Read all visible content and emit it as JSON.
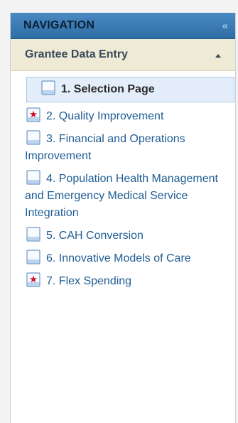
{
  "navigation": {
    "title": "NAVIGATION",
    "collapse_glyph": "«",
    "section": {
      "label": "Grantee Data Entry",
      "expanded": true
    },
    "items": [
      {
        "label": "1. Selection Page",
        "icon": "blank-page-icon",
        "active": true
      },
      {
        "label": "2. Quality Improvement",
        "icon": "flagged-page-icon",
        "active": false
      },
      {
        "label": "3. Financial and Operations Improvement",
        "icon": "blank-page-icon",
        "active": false
      },
      {
        "label": "4. Population Health Management and Emergency Medical Service Integration",
        "icon": "blank-page-icon",
        "active": false
      },
      {
        "label": "5. CAH Conversion",
        "icon": "blank-page-icon",
        "active": false
      },
      {
        "label": "6. Innovative Models of Care",
        "icon": "blank-page-icon",
        "active": false
      },
      {
        "label": "7. Flex Spending",
        "icon": "flagged-page-icon",
        "active": false
      }
    ]
  },
  "colors": {
    "header_bg": "#2e6da4",
    "section_bg": "#efead6",
    "link": "#1f5d94",
    "active_bg": "#e4eefa",
    "flag_red": "#c8102e"
  }
}
